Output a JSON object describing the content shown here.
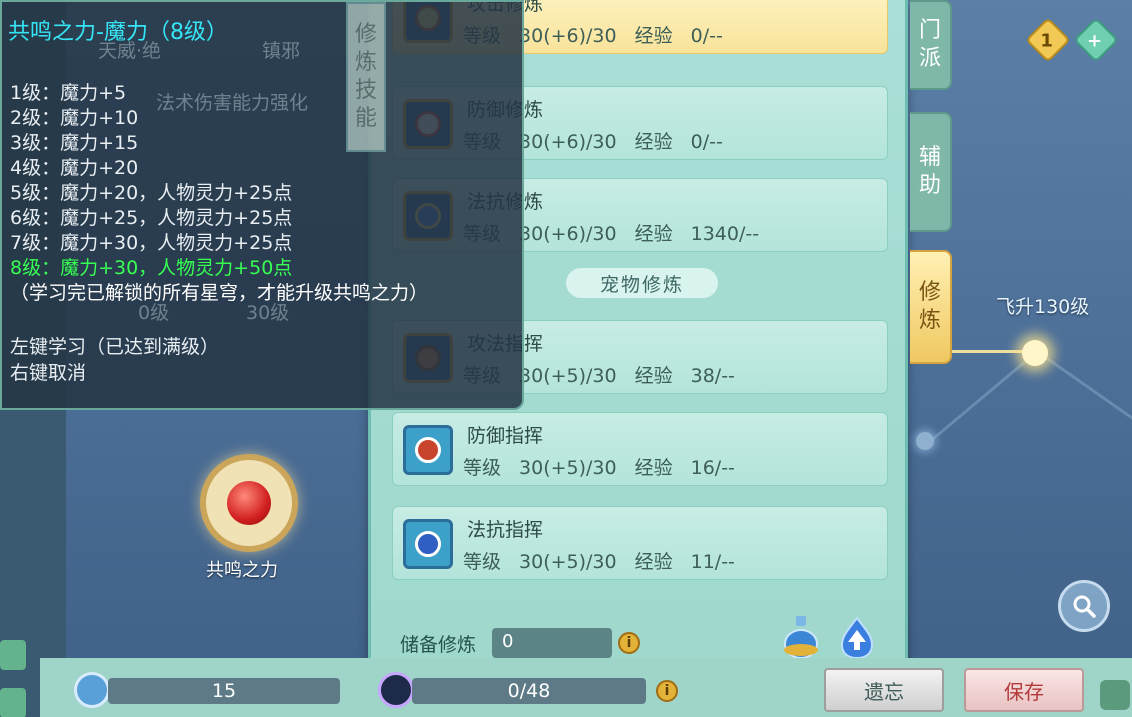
{
  "tooltip": {
    "title": "共鸣之力-魔力（8级）",
    "levels": [
      "1级：魔力+5",
      "2级：魔力+10",
      "3级：魔力+15",
      "4级：魔力+20",
      "5级：魔力+20，人物灵力+25点",
      "6级：魔力+25，人物灵力+25点",
      "7级：魔力+30，人物灵力+25点",
      "8级：魔力+30，人物灵力+50点"
    ],
    "note": "（学习完已解锁的所有星穹，才能升级共鸣之力）",
    "action_learn": "左键学习（已达到满级）",
    "action_cancel": "右键取消",
    "bg_tabs": [
      "天威·绝",
      "镇邪"
    ],
    "bg_desc": "法术伤害能力强化",
    "bg_level_a": "0级",
    "bg_level_b": "30级"
  },
  "cultivation_tab": [
    "修",
    "炼",
    "技",
    "能"
  ],
  "skills": [
    {
      "name": "攻击修炼",
      "level_label": "等级",
      "level": "30(+6)/30",
      "exp_label": "经验",
      "exp": "0/--",
      "active": true
    },
    {
      "name": "防御修炼",
      "level_label": "等级",
      "level": "30(+6)/30",
      "exp_label": "经验",
      "exp": "0/--",
      "active": false
    },
    {
      "name": "法抗修炼",
      "level_label": "等级",
      "level": "30(+6)/30",
      "exp_label": "经验",
      "exp": "1340/--",
      "active": false
    }
  ],
  "pet_header": "宠物修炼",
  "pet_skills": [
    {
      "name": "攻法指挥",
      "level_label": "等级",
      "level": "30(+5)/30",
      "exp_label": "经验",
      "exp": "38/--"
    },
    {
      "name": "防御指挥",
      "level_label": "等级",
      "level": "30(+5)/30",
      "exp_label": "经验",
      "exp": "16/--"
    },
    {
      "name": "法抗指挥",
      "level_label": "等级",
      "level": "30(+5)/30",
      "exp_label": "经验",
      "exp": "11/--"
    }
  ],
  "reserve": {
    "label": "储备修炼",
    "value": "0"
  },
  "side_tabs": [
    {
      "label": [
        "门",
        "派"
      ],
      "active": false
    },
    {
      "label": [
        "辅",
        "助"
      ],
      "active": false
    },
    {
      "label": [
        "修",
        "炼"
      ],
      "active": true
    }
  ],
  "ascend_label": "飞升130级",
  "currency": {
    "count": "1",
    "add": "+"
  },
  "resonance_label": "共鸣之力",
  "bottom": {
    "points": "15",
    "progress": "0/48",
    "info": "i",
    "forget": "遗忘",
    "save": "保存"
  },
  "icons": {
    "search": "search-icon",
    "potion": "potion-icon",
    "upgrade": "flame-upgrade-icon",
    "share": "share-icon"
  }
}
